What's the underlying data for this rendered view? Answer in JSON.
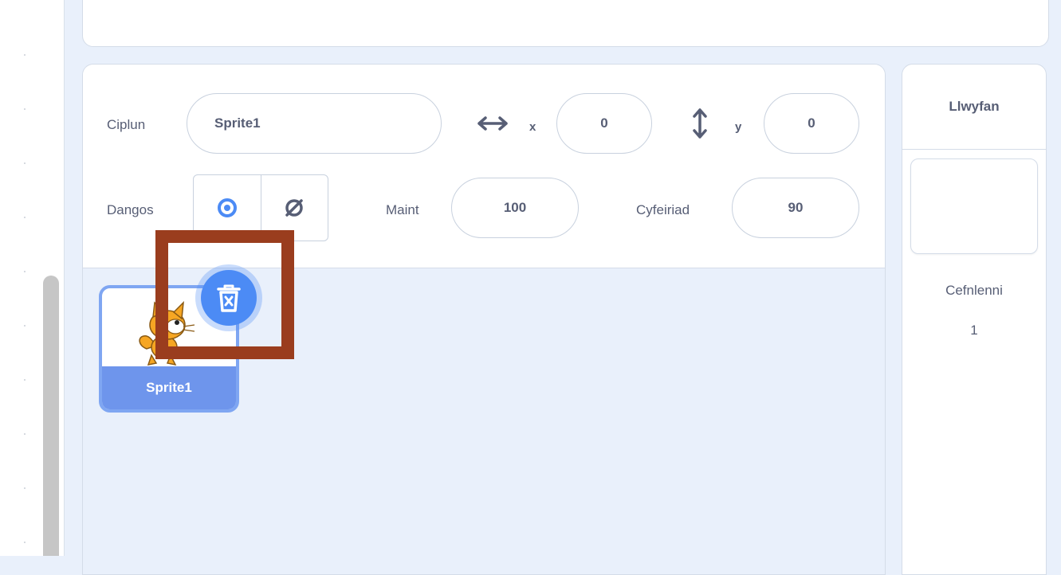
{
  "sprite_info": {
    "name_label": "Ciplun",
    "name_value": "Sprite1",
    "x_label": "x",
    "x_value": "0",
    "y_label": "y",
    "y_value": "0",
    "show_label": "Dangos",
    "size_label": "Maint",
    "size_value": "100",
    "direction_label": "Cyfeiriad",
    "direction_value": "90"
  },
  "sprites": [
    {
      "name": "Sprite1",
      "selected": true
    }
  ],
  "stage": {
    "title": "Llwyfan",
    "backdrops_label": "Cefnlenni",
    "backdrops_count": "1"
  },
  "colors": {
    "accent": "#4c8bf5",
    "tile_footer": "#6e95ec",
    "highlight": "#9a3d1e",
    "text": "#575e75"
  },
  "icons": [
    "horizontal-arrow-icon",
    "vertical-arrow-icon",
    "eye-icon",
    "eye-slash-icon",
    "trash-icon",
    "cat-sprite-icon"
  ]
}
